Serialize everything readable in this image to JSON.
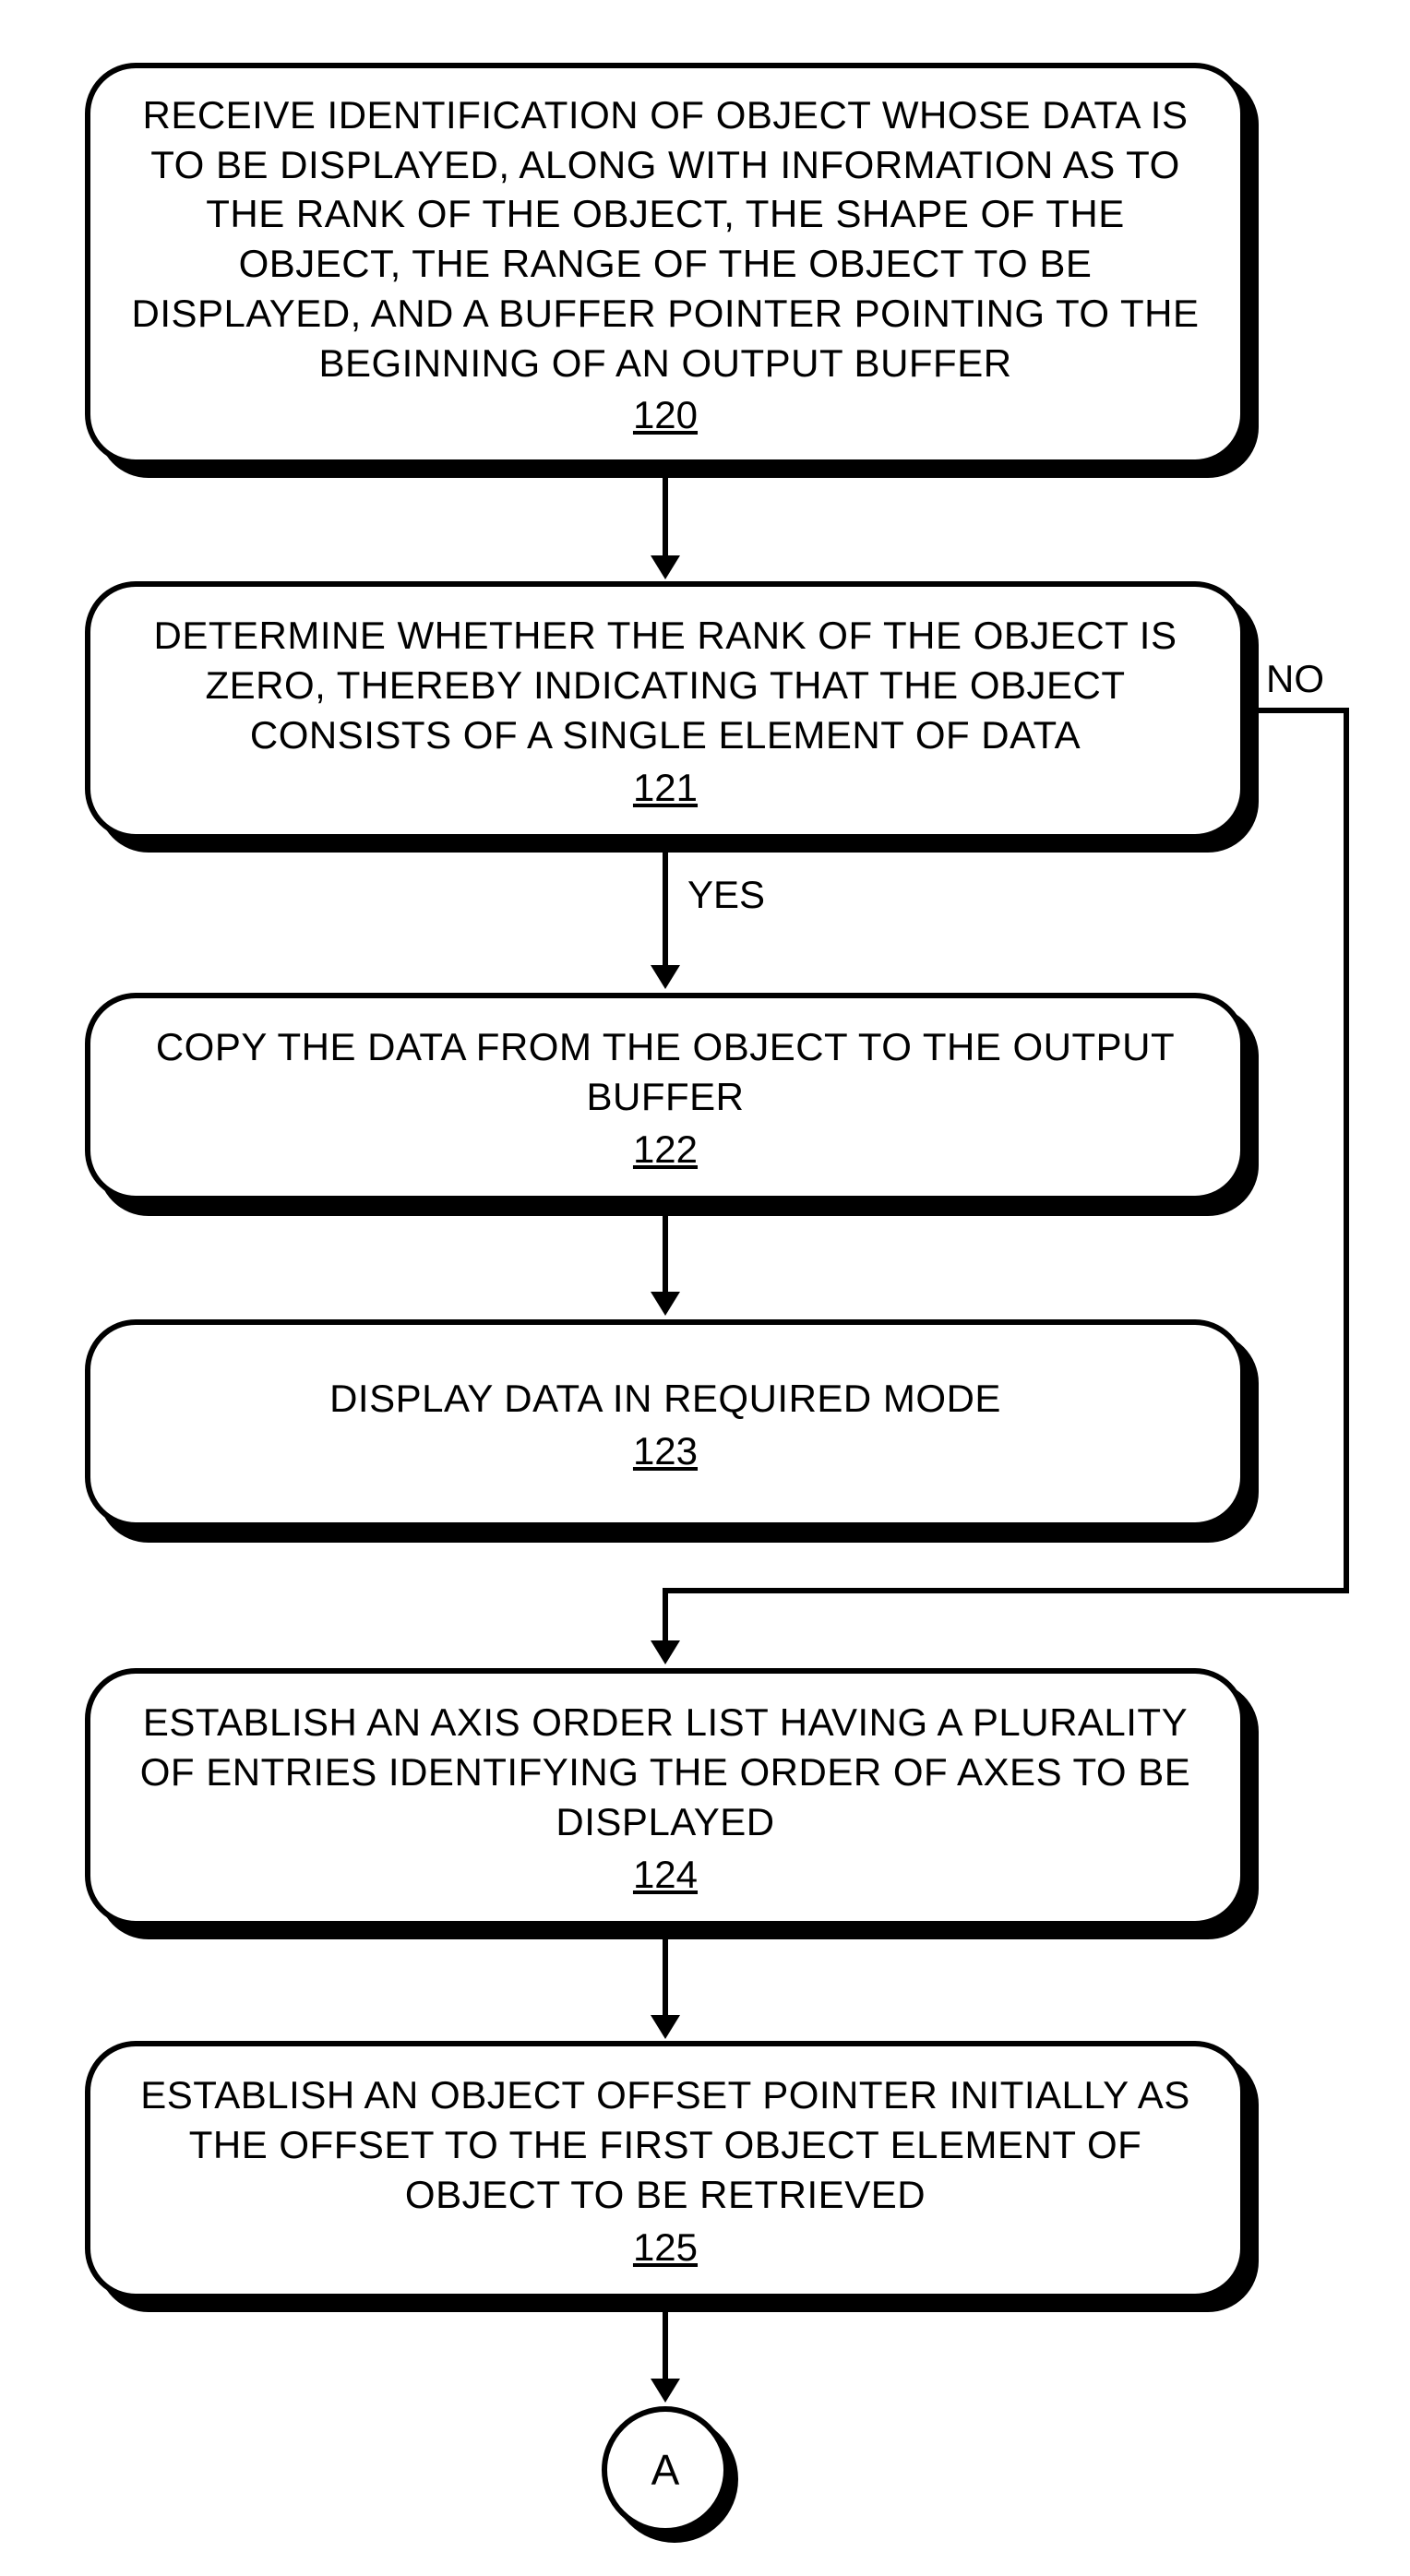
{
  "flowchart": {
    "nodes": {
      "n120": {
        "text": "RECEIVE IDENTIFICATION OF OBJECT WHOSE DATA IS TO BE DISPLAYED, ALONG WITH INFORMATION AS TO THE RANK OF THE OBJECT, THE SHAPE OF THE OBJECT, THE RANGE OF THE OBJECT TO BE DISPLAYED, AND A BUFFER POINTER POINTING TO THE BEGINNING OF AN OUTPUT BUFFER",
        "ref": "120"
      },
      "n121": {
        "text": "DETERMINE WHETHER THE RANK OF THE OBJECT IS ZERO, THEREBY INDICATING THAT THE OBJECT CONSISTS OF A SINGLE ELEMENT OF DATA",
        "ref": "121"
      },
      "n122": {
        "text": "COPY THE DATA FROM THE OBJECT TO THE OUTPUT BUFFER",
        "ref": "122"
      },
      "n123": {
        "text": "DISPLAY DATA IN REQUIRED MODE",
        "ref": "123"
      },
      "n124": {
        "text": "ESTABLISH AN AXIS ORDER LIST HAVING A PLURALITY OF ENTRIES IDENTIFYING THE ORDER OF AXES TO BE DISPLAYED",
        "ref": "124"
      },
      "n125": {
        "text": "ESTABLISH AN OBJECT OFFSET POINTER INITIALLY AS THE OFFSET TO THE FIRST OBJECT ELEMENT OF OBJECT TO BE RETRIEVED",
        "ref": "125"
      }
    },
    "edges": {
      "yes": "YES",
      "no": "NO"
    },
    "connector": {
      "a": "A"
    }
  }
}
